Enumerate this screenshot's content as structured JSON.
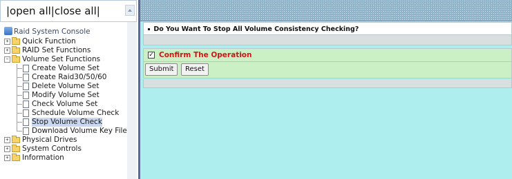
{
  "left_frame": {
    "top_links": "|open all|close all|",
    "tree": {
      "root_label": "Raid System Console",
      "groups": [
        {
          "label": "Quick Function",
          "expanded": false
        },
        {
          "label": "RAID Set Functions",
          "expanded": false
        },
        {
          "label": "Volume Set Functions",
          "expanded": true,
          "children": [
            "Create Volume Set",
            "Create Raid30/50/60",
            "Delete Volume Set",
            "Modify Volume Set",
            "Check Volume Set",
            "Schedule Volume Check",
            "Stop Volume Check",
            "Download Volume Key File"
          ],
          "selected_child": "Stop Volume Check"
        },
        {
          "label": "Physical Drives",
          "expanded": false
        },
        {
          "label": "System Controls",
          "expanded": false
        },
        {
          "label": "Information",
          "expanded": false
        }
      ]
    }
  },
  "right_frame": {
    "question": "Do You Want To Stop All Volume Consistency Checking?",
    "confirm": {
      "label": "Confirm The Operation",
      "checked": true,
      "checkmark": "✓"
    },
    "buttons": {
      "submit": "Submit",
      "reset": "Reset"
    }
  },
  "colors": {
    "content_bg": "#aeeeee",
    "confirm_bg": "#ccf0c6",
    "confirm_text": "#d21414",
    "selected_bg": "#c9d8f0"
  }
}
